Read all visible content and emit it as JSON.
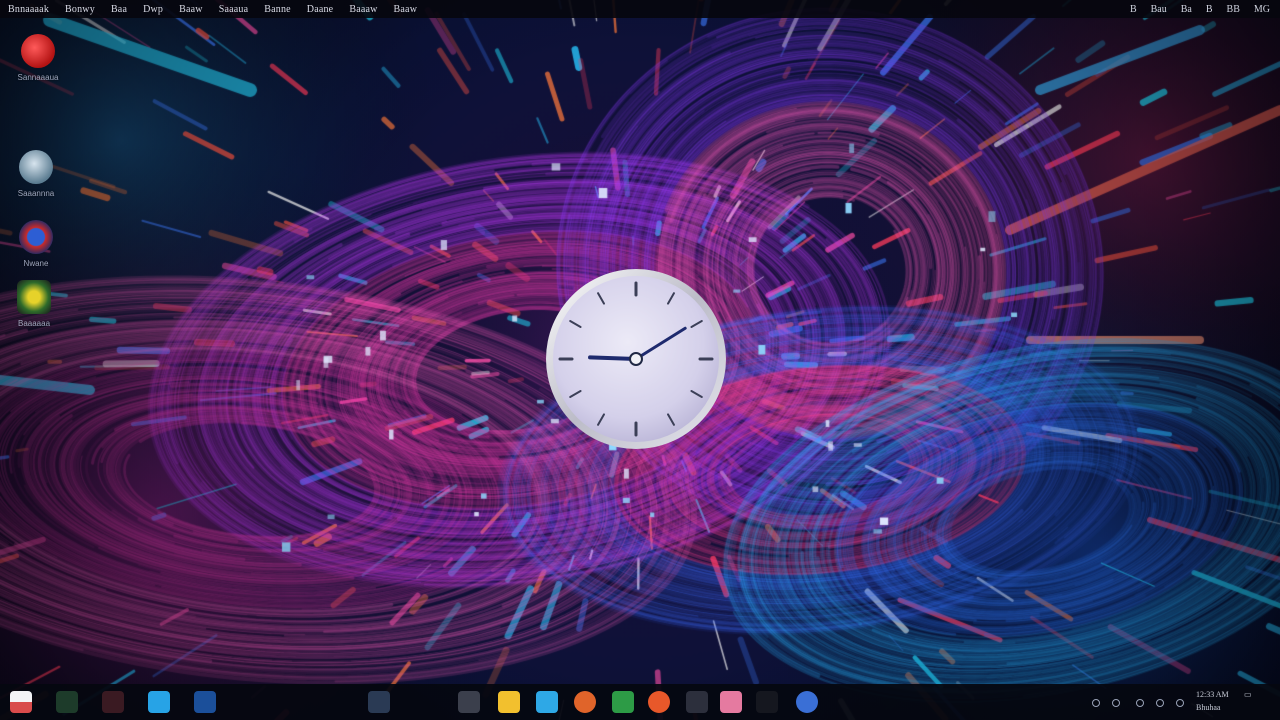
{
  "menubar": {
    "items": [
      "Bnnaaaak",
      "Bonwy",
      "Baa",
      "Dwp",
      "Baaw",
      "Saaaua",
      "Banne",
      "Daane",
      "Baaaw",
      "Baaw"
    ],
    "right": [
      "B",
      "Bau",
      "Ba",
      "B",
      "BB",
      "MG"
    ]
  },
  "desktop_icons": [
    {
      "label": "Sannaaaua",
      "icon": "red-app-icon"
    },
    {
      "label": "Saaannna",
      "icon": "globe-icon"
    },
    {
      "label": "Nwane",
      "icon": "browser-icon"
    },
    {
      "label": "Baaaaaa",
      "icon": "game-app-icon"
    }
  ],
  "clock": {
    "hour_hand_angle_deg": 272,
    "minute_hand_angle_deg": 58
  },
  "taskbar": {
    "apps": [
      {
        "name": "start-app-icon",
        "color": "#e8e8ec"
      },
      {
        "name": "app-dark-green-icon",
        "color": "#1d3b2a"
      },
      {
        "name": "app-dark-red-icon",
        "color": "#3a1a22"
      },
      {
        "name": "app-cyan-icon",
        "color": "#27a3e6"
      },
      {
        "name": "app-blue-icon",
        "color": "#1b4f9a"
      },
      {
        "name": "app-slate-icon",
        "color": "#2a3a54"
      },
      {
        "name": "app-gray-icon",
        "color": "#3b3f4c"
      },
      {
        "name": "files-icon",
        "color": "#f2c02e"
      },
      {
        "name": "store-icon",
        "color": "#2ea8e6"
      },
      {
        "name": "browser-orange-icon",
        "color": "#e0642a"
      },
      {
        "name": "xbox-icon",
        "color": "#2d9b46"
      },
      {
        "name": "media-orange-icon",
        "color": "#e8582a"
      },
      {
        "name": "app-dark-icon",
        "color": "#2c2f3c"
      },
      {
        "name": "photos-icon",
        "color": "#e57aa0"
      },
      {
        "name": "app-black-icon",
        "color": "#15171f"
      },
      {
        "name": "browser-blue-icon",
        "color": "#3a6fd6"
      }
    ],
    "tray_time": "12:33 AM",
    "tray_date": "Bhuhaa"
  }
}
